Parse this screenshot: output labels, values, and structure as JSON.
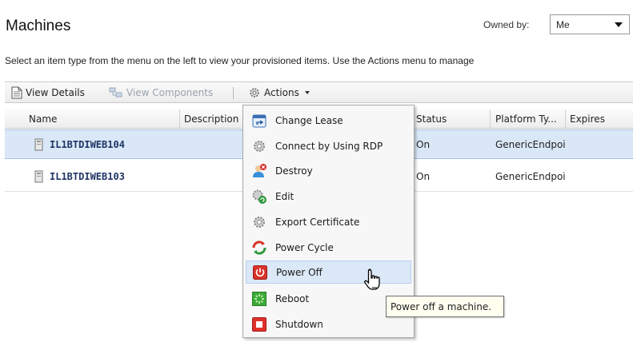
{
  "header": {
    "title": "Machines",
    "owned_by_label": "Owned by:",
    "owned_by_value": "Me"
  },
  "intro_text": "Select an item type from the menu on the left to view your provisioned items. Use the Actions menu to manage",
  "toolbar": {
    "view_details": "View Details",
    "view_components": "View Components",
    "actions": "Actions"
  },
  "columns": [
    "Name",
    "Description",
    "Status",
    "Platform Ty...",
    "Expires"
  ],
  "rows": [
    {
      "name": "IL1BTDIWEB104",
      "status": "On",
      "platform": "GenericEndpoi",
      "selected": true
    },
    {
      "name": "IL1BTDIWEB103",
      "status": "On",
      "platform": "GenericEndpoi",
      "selected": false
    }
  ],
  "actions_menu": {
    "items": [
      {
        "label": "Change Lease",
        "icon": "calendar-icon"
      },
      {
        "label": "Connect by Using RDP",
        "icon": "gear-icon"
      },
      {
        "label": "Destroy",
        "icon": "destroy-icon"
      },
      {
        "label": "Edit",
        "icon": "edit-icon"
      },
      {
        "label": "Export Certificate",
        "icon": "gear-icon"
      },
      {
        "label": "Power Cycle",
        "icon": "power-cycle-icon"
      },
      {
        "label": "Power Off",
        "icon": "power-off-icon"
      },
      {
        "label": "Reboot",
        "icon": "reboot-icon"
      },
      {
        "label": "Shutdown",
        "icon": "shutdown-icon"
      }
    ],
    "hovered": "Power Off"
  },
  "tooltip": "Power off a machine.",
  "colors": {
    "selected_row": "#d9e7f7",
    "name_text": "#1e3464",
    "menu_hover": "#dbe8f7"
  }
}
